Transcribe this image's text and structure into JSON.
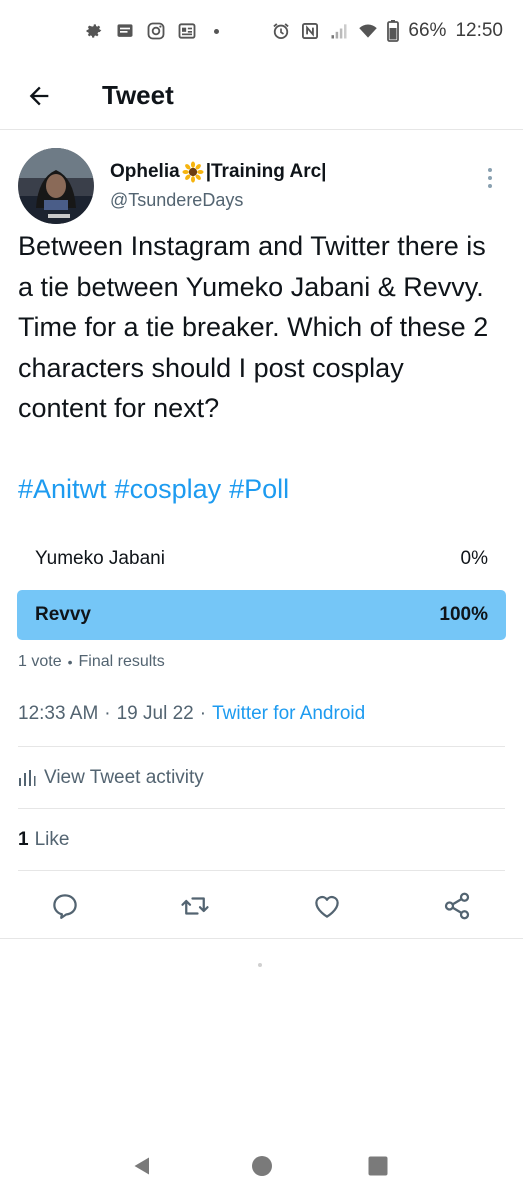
{
  "status_bar": {
    "battery": "66%",
    "time": "12:50"
  },
  "header": {
    "title": "Tweet"
  },
  "author": {
    "display_name_before": "Ophelia",
    "display_name_after": "|Training Arc|",
    "handle": "@TsundereDays"
  },
  "tweet": {
    "text": "Between Instagram and Twitter there is a tie between Yumeko Jabani & Revvy. Time for a tie breaker. Which of these 2 characters should I post cosplay content for next?",
    "hashtags": [
      "#Anitwt",
      "#cosplay",
      "#Poll"
    ]
  },
  "poll": {
    "options": [
      {
        "label": "Yumeko Jabani",
        "percent": "0%"
      },
      {
        "label": "Revvy",
        "percent": "100%"
      }
    ],
    "votes": "1 vote",
    "status": "Final results"
  },
  "timestamp": {
    "time": "12:33 AM",
    "date": "19 Jul 22",
    "source": "Twitter for Android"
  },
  "activity": {
    "label": "View Tweet activity"
  },
  "likes": {
    "count": "1",
    "label": "Like"
  },
  "colors": {
    "accent": "#1d9bf0",
    "poll_winner": "#75c6f7",
    "secondary_text": "#536471"
  },
  "icons": {
    "back": "arrow-left-icon",
    "more": "vertical-dots-icon",
    "reply": "reply-icon",
    "retweet": "retweet-icon",
    "like": "heart-icon",
    "share": "share-icon",
    "activity": "bar-chart-icon"
  }
}
